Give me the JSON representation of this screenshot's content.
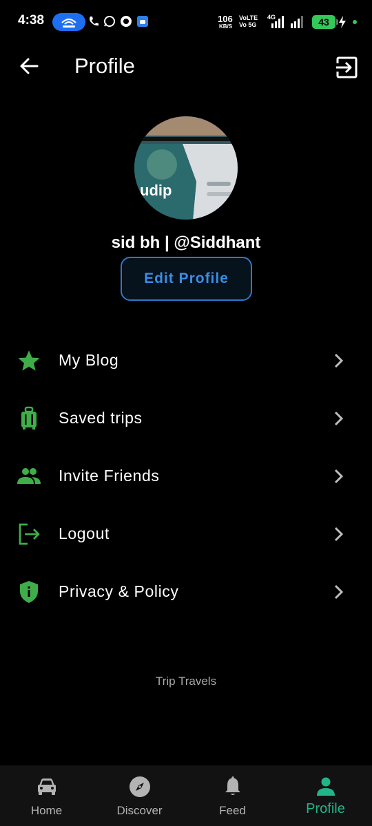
{
  "status_bar": {
    "time": "4:38",
    "speed_value": "106",
    "speed_unit": "KB/S",
    "volte_1": "VoLTE",
    "volte_2": "Vo 5G",
    "network": "4G",
    "battery": "43"
  },
  "app_bar": {
    "title": "Profile",
    "back_icon": "arrow-left-icon",
    "exit_icon": "exit-to-app-icon"
  },
  "profile": {
    "user_line": "sid bh | @Siddhant",
    "edit_button": "Edit Profile"
  },
  "menu": {
    "items": [
      {
        "label": "My Blog",
        "icon": "star-icon"
      },
      {
        "label": "Saved trips",
        "icon": "luggage-icon"
      },
      {
        "label": "Invite Friends",
        "icon": "people-icon"
      },
      {
        "label": "Logout",
        "icon": "logout-icon"
      },
      {
        "label": "Privacy & Policy",
        "icon": "shield-info-icon"
      }
    ]
  },
  "footer": {
    "brand": "Trip Travels"
  },
  "bottom_nav": {
    "items": [
      {
        "label": "Home",
        "icon": "car-icon"
      },
      {
        "label": "Discover",
        "icon": "compass-icon"
      },
      {
        "label": "Feed",
        "icon": "bell-icon"
      },
      {
        "label": "Profile",
        "icon": "person-icon"
      }
    ],
    "active": "Profile"
  },
  "colors": {
    "background": "#000000",
    "accent_green": "#3fae4a",
    "nav_active": "#22b489",
    "edit_button_blue": "#3a8ee6"
  }
}
